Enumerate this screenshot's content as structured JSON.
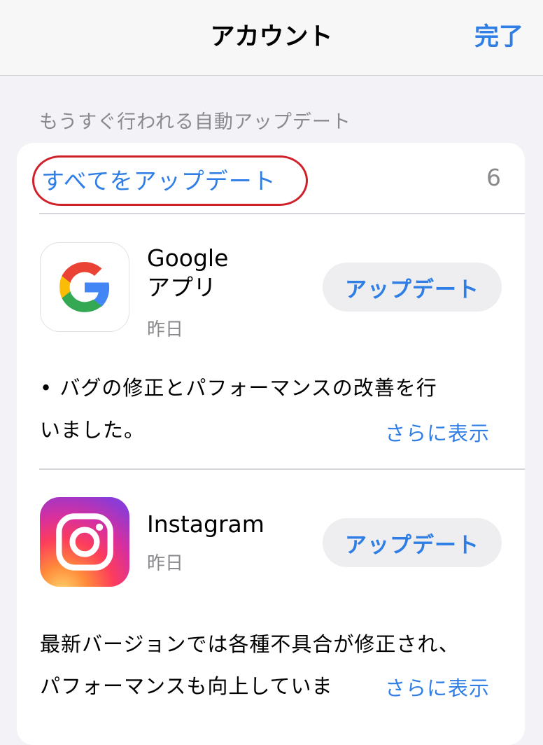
{
  "navbar": {
    "title": "アカウント",
    "done_label": "完了"
  },
  "section": {
    "header": "もうすぐ行われる自動アップデート"
  },
  "updates": {
    "update_all_label": "すべてをアップデート",
    "count": "6"
  },
  "apps": [
    {
      "name_line1": "Google",
      "name_line2": "アプリ",
      "date": "昨日",
      "button_label": "アップデート",
      "notes_line1": "• バグの修正とパフォーマンスの改善を行",
      "notes_line2": "いました。",
      "more_label": "さらに表示",
      "icon": "google-g-icon"
    },
    {
      "name_line1": "Instagram",
      "date": "昨日",
      "button_label": "アップデート",
      "notes_line1": "最新バージョンでは各種不具合が修正され、",
      "notes_line2": "パフォーマンスも向上していま",
      "more_label": "さらに表示",
      "icon": "instagram-camera-icon"
    }
  ],
  "colors": {
    "accent": "#2f7ee6",
    "secondary_text": "#8a8a8e",
    "highlight": "#d0202a"
  }
}
